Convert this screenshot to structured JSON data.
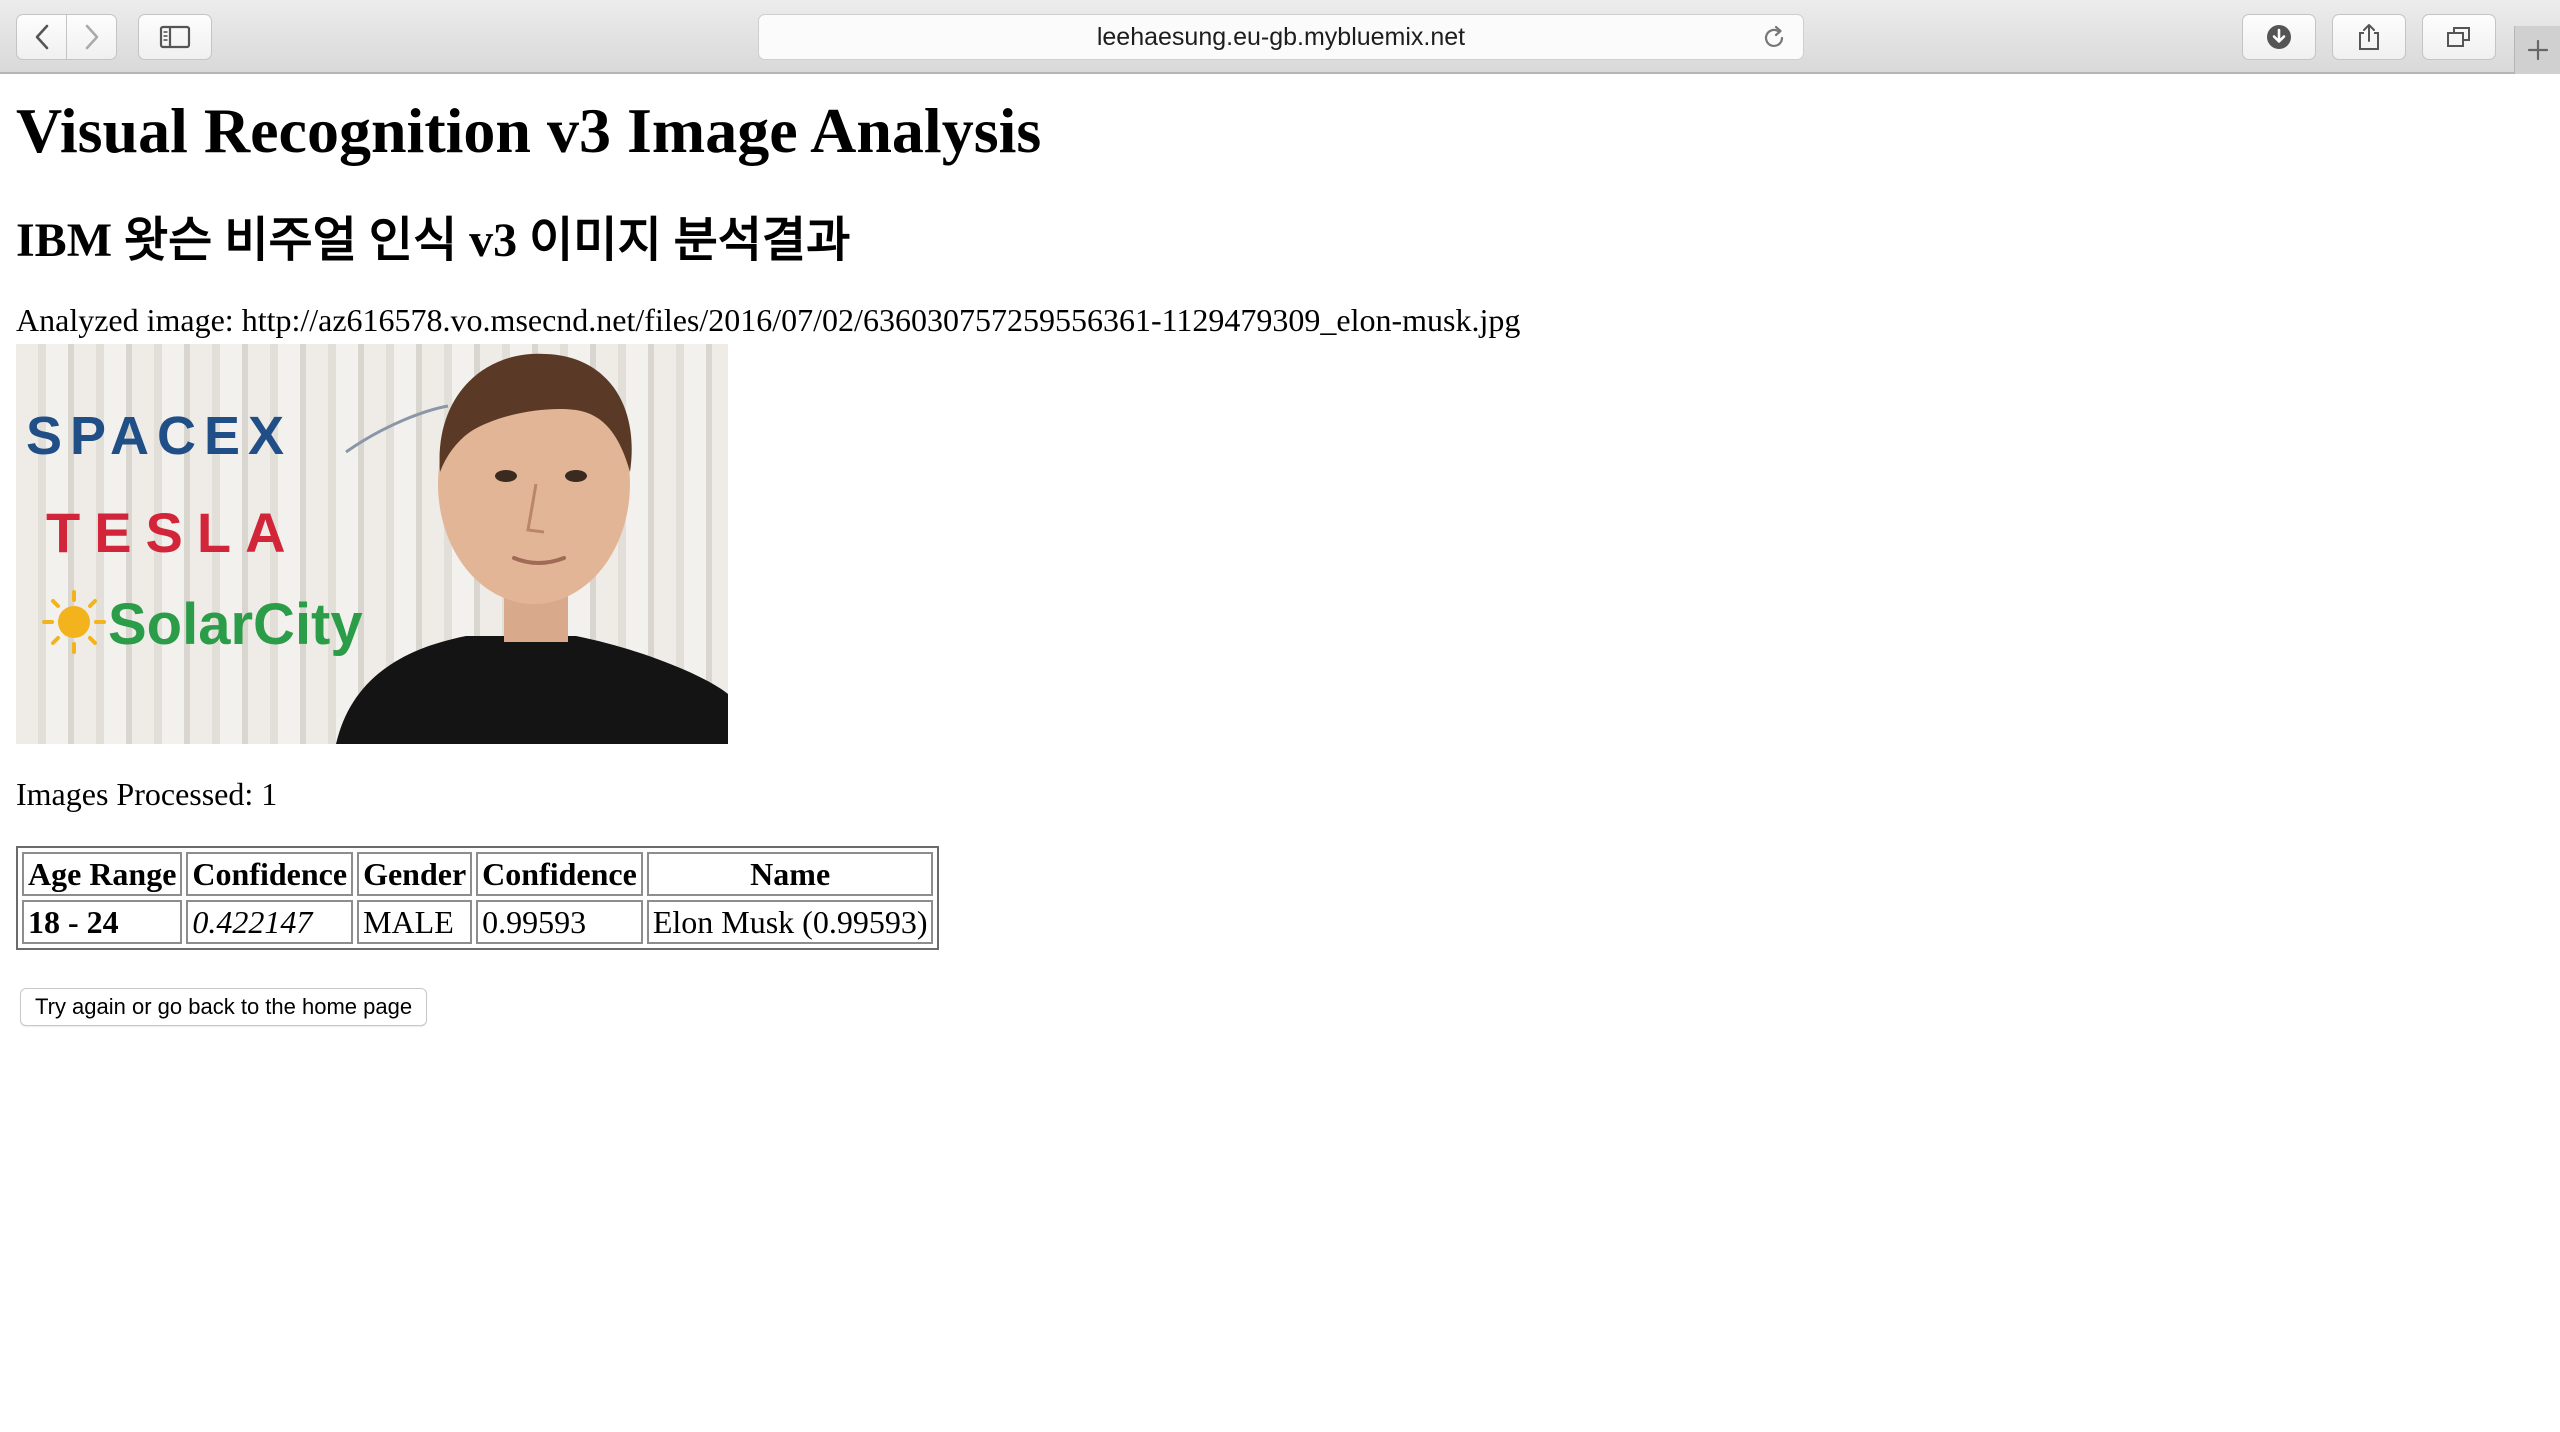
{
  "browser": {
    "url": "leehaesung.eu-gb.mybluemix.net"
  },
  "page": {
    "title": "Visual Recognition v3 Image Analysis",
    "subtitle": "IBM 왓슨 비주얼 인식 v3 이미지 분석결과",
    "analyzed_prefix": "Analyzed image: ",
    "analyzed_url": "http://az616578.vo.msecnd.net/files/2016/07/02/636030757259556361-1129479309_elon-musk.jpg",
    "image_logos": {
      "spacex": "SPACEX",
      "tesla": "TESLA",
      "solarcity": "SolarCity"
    },
    "images_processed": "Images Processed: 1",
    "table": {
      "headers": [
        "Age Range",
        "Confidence",
        "Gender",
        "Confidence",
        "Name"
      ],
      "row": {
        "age_range": "18 - 24",
        "age_confidence": "0.422147",
        "gender": "MALE",
        "gender_confidence": "0.99593",
        "name": "Elon Musk (0.99593)"
      }
    },
    "home_button": "Try again or go back to the home page"
  }
}
